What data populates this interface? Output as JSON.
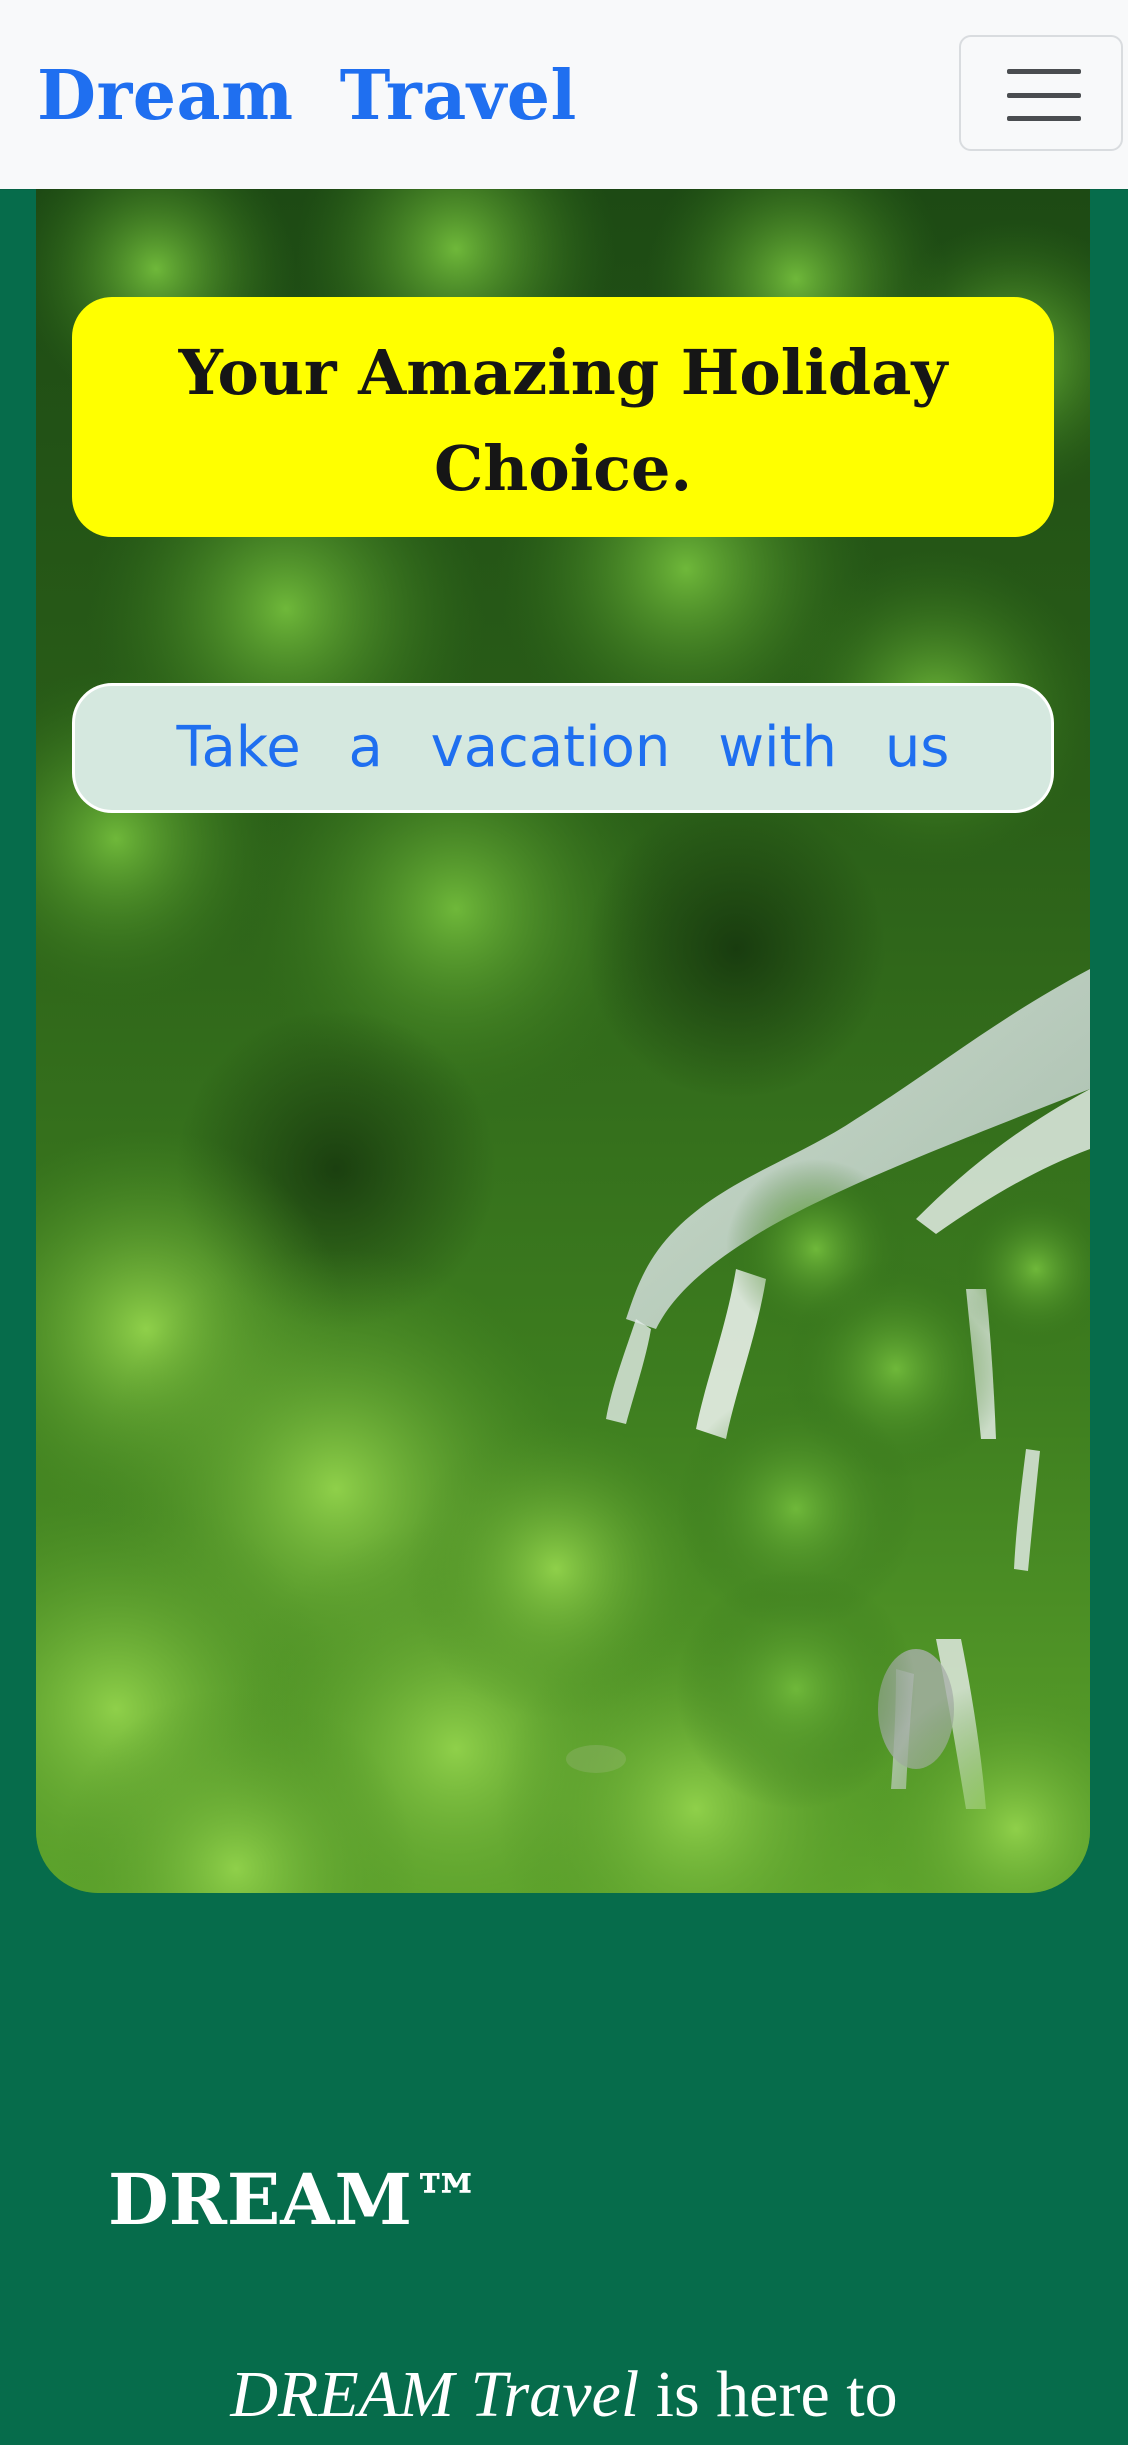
{
  "navbar": {
    "brand": "Dream Travel",
    "toggle_icon": "hamburger-menu-icon"
  },
  "hero": {
    "background_image": "forest-waterfall-photo",
    "headline": "Your Amazing Holiday Choice.",
    "cta_label": "Take a vacation with us"
  },
  "about": {
    "title": "DREAM™",
    "intro_emphasis": "DREAM Travel",
    "intro_rest": " is here to"
  },
  "colors": {
    "page_background": "#066c4b",
    "brand_blue": "#1f6ff0",
    "headline_box": "#ffff00",
    "cta_box": "#d5e8df",
    "navbar": "#f8f9fa"
  }
}
